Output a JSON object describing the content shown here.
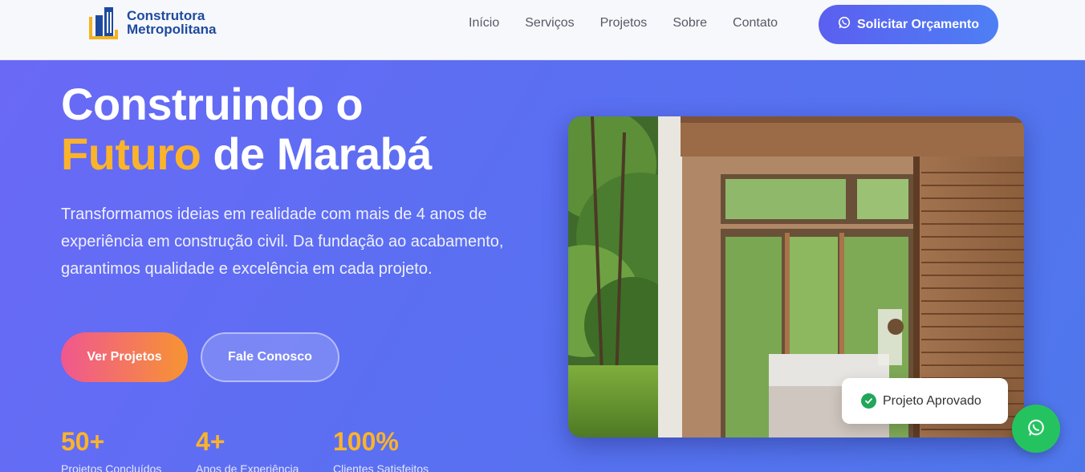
{
  "header": {
    "logo": {
      "line1": "Construtora",
      "line2": "Metropolitana"
    },
    "nav": [
      "Início",
      "Serviços",
      "Projetos",
      "Sobre",
      "Contato"
    ],
    "cta_label": "Solicitar Orçamento"
  },
  "hero": {
    "title_line1": "Construindo o",
    "title_accent": "Futuro",
    "title_rest": "de Marabá",
    "description": "Transformamos ideias em realidade com mais de 4 anos de experiência em construção civil. Da fundação ao acabamento, garantimos qualidade e excelência em cada projeto.",
    "primary_button": "Ver Projetos",
    "secondary_button": "Fale Conosco",
    "stats": [
      {
        "value": "50+",
        "label": "Projetos Concluídos"
      },
      {
        "value": "4+",
        "label": "Anos de Experiência"
      },
      {
        "value": "100%",
        "label": "Clientes Satisfeitos"
      }
    ],
    "badge_label": "Projeto Aprovado"
  },
  "colors": {
    "accent": "#fbb32a",
    "brand_blue": "#1e4a9e",
    "cta_gradient_start": "#5b5ff0",
    "whatsapp_green": "#25c35f"
  },
  "icons": {
    "cta": "whatsapp-icon",
    "badge": "check-circle-icon",
    "fab": "whatsapp-icon",
    "logo": "building-icon"
  }
}
